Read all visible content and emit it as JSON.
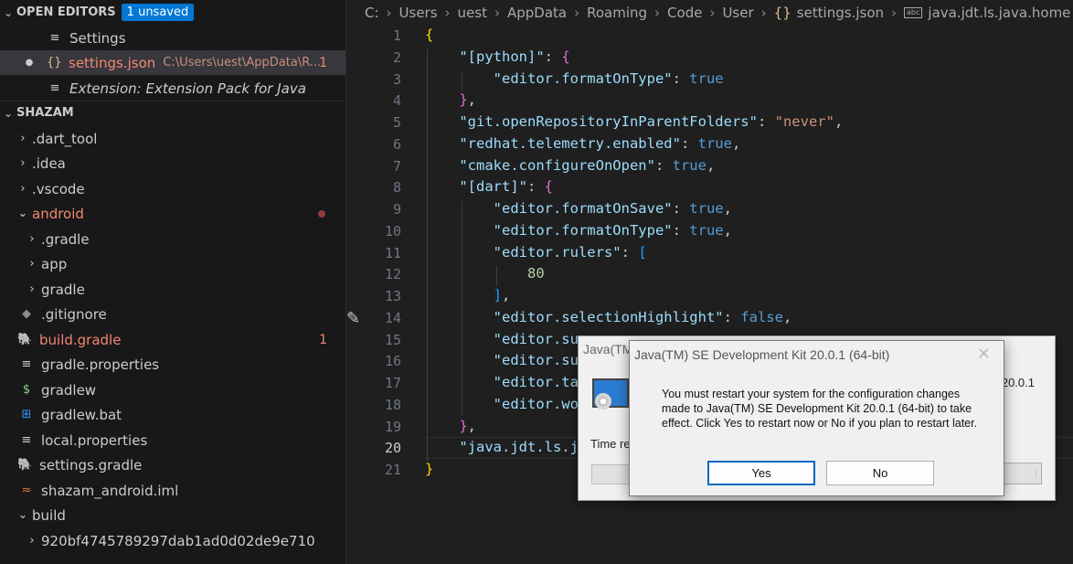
{
  "open_editors": {
    "header": "OPEN EDITORS",
    "badge": "1 unsaved",
    "items": [
      {
        "label": "Settings"
      },
      {
        "label": "settings.json",
        "desc": "C:\\Users\\uest\\AppData\\R...",
        "count": "1"
      },
      {
        "label": "Extension: Extension Pack for Java"
      }
    ]
  },
  "explorer": {
    "header": "SHAZAM",
    "items": [
      {
        "label": ".dart_tool"
      },
      {
        "label": ".idea"
      },
      {
        "label": ".vscode"
      },
      {
        "label": "android"
      },
      {
        "label": ".gradle"
      },
      {
        "label": "app"
      },
      {
        "label": "gradle"
      },
      {
        "label": ".gitignore"
      },
      {
        "label": "build.gradle",
        "count": "1"
      },
      {
        "label": "gradle.properties"
      },
      {
        "label": "gradlew"
      },
      {
        "label": "gradlew.bat"
      },
      {
        "label": "local.properties"
      },
      {
        "label": "settings.gradle"
      },
      {
        "label": "shazam_android.iml"
      },
      {
        "label": "build"
      },
      {
        "label": "920bf4745789297dab1ad0d02de9e710"
      }
    ]
  },
  "breadcrumb": [
    "C:",
    "Users",
    "uest",
    "AppData",
    "Roaming",
    "Code",
    "User",
    "settings.json",
    "java.jdt.ls.java.home"
  ],
  "code": {
    "line_numbers": [
      "1",
      "2",
      "3",
      "4",
      "5",
      "6",
      "7",
      "8",
      "9",
      "10",
      "11",
      "12",
      "13",
      "14",
      "15",
      "16",
      "17",
      "18",
      "19",
      "20",
      "21"
    ],
    "t": {
      "lb": "{",
      "rb": "}",
      "lsq": "[",
      "rsq": "]",
      "colon": ": ",
      "comma": ",",
      "python_key": "\"[python]\"",
      "fot_key": "\"editor.formatOnType\"",
      "true": "true",
      "false": "false",
      "git_key": "\"git.openRepositoryInParentFolders\"",
      "never": "\"never\"",
      "redhat_key": "\"redhat.telemetry.enabled\"",
      "cmake_key": "\"cmake.configureOnOpen\"",
      "dart_key": "\"[dart]\"",
      "fos_key": "\"editor.formatOnSave\"",
      "rulers_key": "\"editor.rulers\"",
      "eighty": "80",
      "sel_key": "\"editor.selectionHighlight\"",
      "l15": "\"editor.su",
      "l16": "\"editor.su",
      "l17": "\"editor.ta",
      "l18": "\"editor.wo",
      "l20": "\"java.jdt.ls.j"
    }
  },
  "dialog_back": {
    "title": "Java(TM",
    "version": "20.0.1",
    "timer_label": "Time re",
    "cancel_label": "l"
  },
  "dialog": {
    "title": "Java(TM) SE Development Kit 20.0.1 (64-bit)",
    "close": "✕",
    "message": "You must restart your system for the configuration changes made to Java(TM) SE Development Kit 20.0.1 (64-bit) to take effect. Click Yes to restart now or No if you plan to restart later.",
    "yes": "Yes",
    "no": "No"
  }
}
